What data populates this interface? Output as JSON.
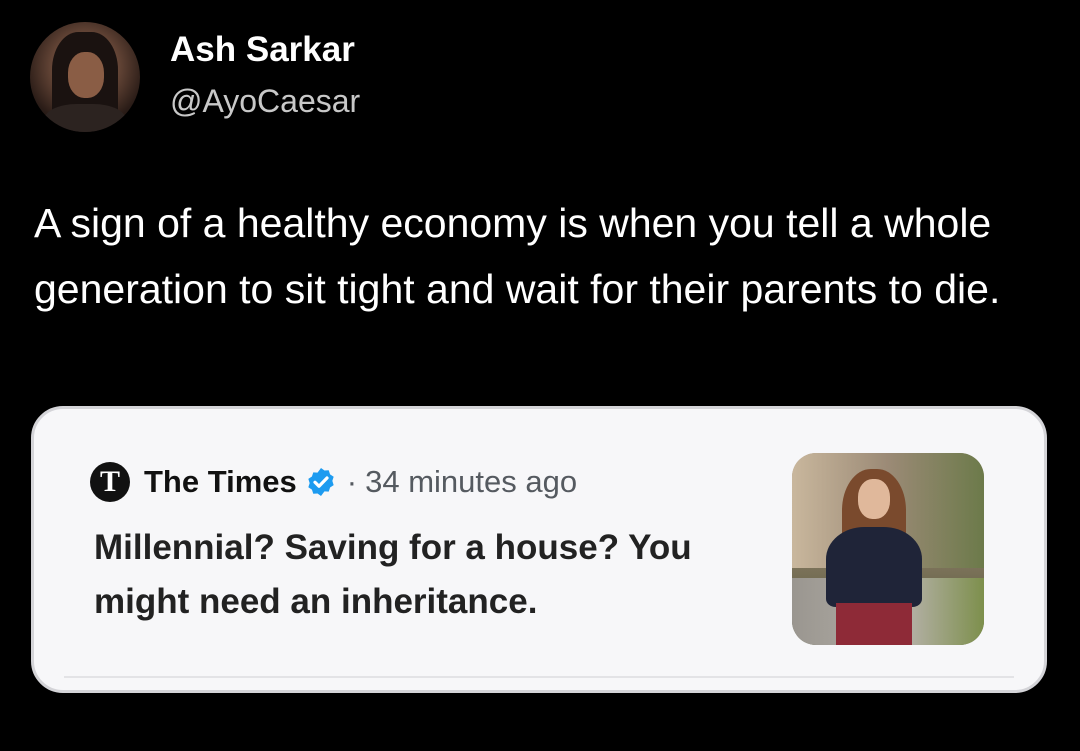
{
  "author": {
    "name": "Ash Sarkar",
    "handle": "@AyoCaesar",
    "avatar_icon": "profile-photo"
  },
  "tweet": {
    "text": "A sign of a healthy economy is when you tell a whole generation to sit tight and wait for their parents to die."
  },
  "quoted": {
    "source_logo_letter": "T",
    "source_name": "The Times",
    "verified_icon": "verified-badge-icon",
    "verified_color": "#1d9bf0",
    "separator": "·",
    "time_ago": "34 minutes ago",
    "headline": "Millennial? Saving for a house? You might need an inheritance.",
    "thumbnail_icon": "article-photo"
  },
  "colors": {
    "background": "#000000",
    "card_background": "#f7f7f9",
    "handle_text": "#c8c8c8"
  }
}
